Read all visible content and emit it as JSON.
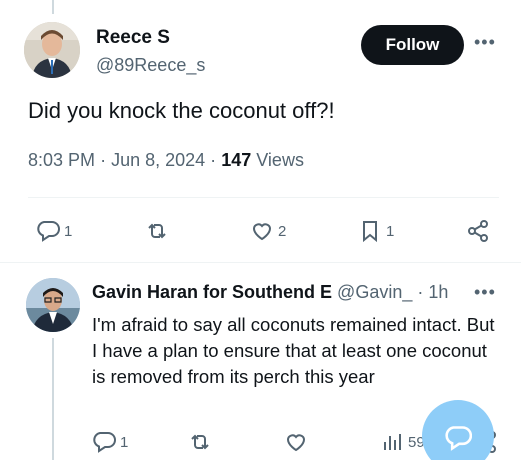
{
  "main_tweet": {
    "author_name": "Reece S",
    "author_handle": "@89Reece_s",
    "follow_label": "Follow",
    "more_label": "•••",
    "text": "Did you knock the coconut off?!",
    "time": "8:03 PM",
    "separator": "·",
    "date": "Jun 8, 2024",
    "views_count": "147",
    "views_label": "Views",
    "actions": {
      "reply_count": "1",
      "retweet_count": "",
      "like_count": "2",
      "bookmark_count": "1"
    }
  },
  "reply_tweet": {
    "author_name": "Gavin Haran for Southend E",
    "author_handle": "@Gavin_",
    "separator": "·",
    "time": "1h",
    "more_label": "•••",
    "text": "I'm afraid to say all coconuts remained intact. But I have a plan to ensure that at least one coconut is removed from its perch this year",
    "actions": {
      "reply_count": "1",
      "retweet_count": "",
      "like_count": "",
      "views_count": "59"
    }
  },
  "colors": {
    "text_primary": "#0f1419",
    "text_secondary": "#536471",
    "follow_bg": "#0f1419",
    "fab_bg": "#8ecdf8",
    "divider": "#eff3f4"
  },
  "icons": [
    "reply-icon",
    "retweet-icon",
    "like-icon",
    "bookmark-icon",
    "share-icon",
    "views-icon",
    "compose-icon"
  ]
}
